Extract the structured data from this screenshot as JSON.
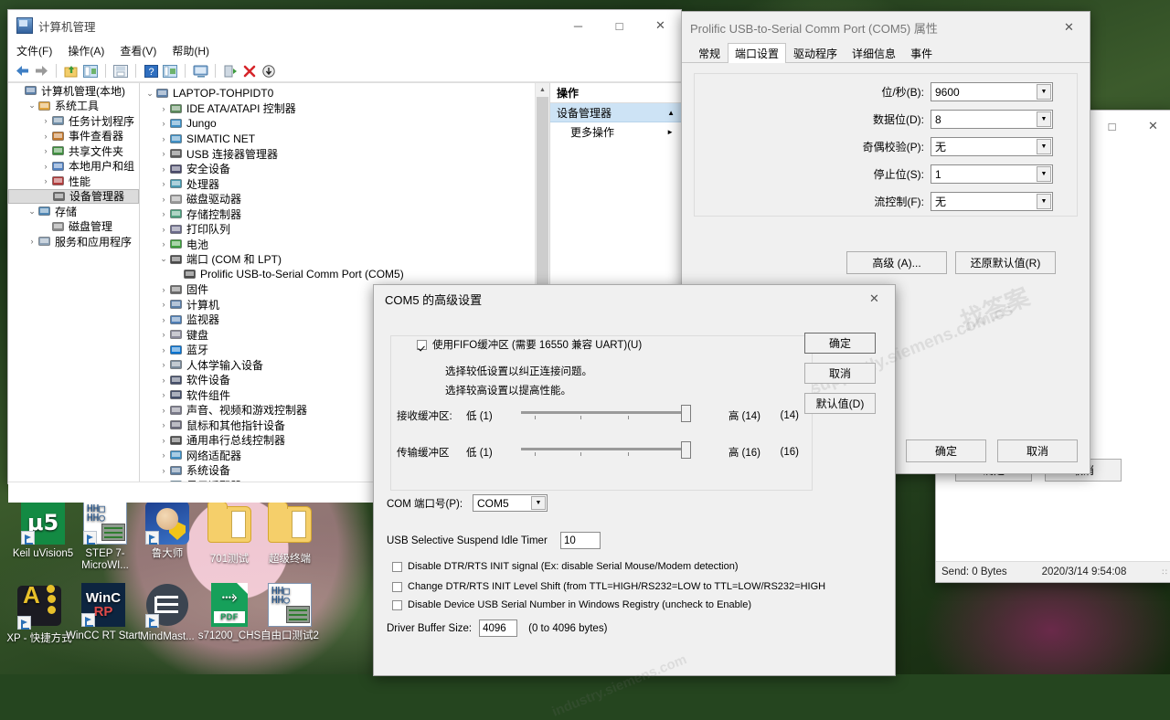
{
  "desktop": {
    "icons": [
      {
        "label": "Keil uVision5",
        "art": "keil"
      },
      {
        "label": "STEP 7-MicroWI...",
        "art": "step7"
      },
      {
        "label": "鲁大师",
        "art": "ludashi"
      },
      {
        "label": "701测试",
        "art": "folder"
      },
      {
        "label": "超级终端",
        "art": "folder"
      },
      {
        "label": "XP - 快捷方式",
        "art": "xpshort"
      },
      {
        "label": "WinCC RT Start",
        "art": "wincc"
      },
      {
        "label": "MindMast...",
        "art": "mind"
      },
      {
        "label": "s71200_CHS",
        "art": "pdf"
      },
      {
        "label": "自由口测试2",
        "art": "step7"
      }
    ]
  },
  "computer_management": {
    "title": "计算机管理",
    "menu": [
      "文件(F)",
      "操作(A)",
      "查看(V)",
      "帮助(H)"
    ],
    "window_buttons": {
      "minimize": "─",
      "maximize": "□",
      "close": "✕"
    },
    "left_tree": [
      {
        "label": "计算机管理(本地)",
        "depth": 0,
        "twisty": "",
        "icon": "computer-icon"
      },
      {
        "label": "系统工具",
        "depth": 1,
        "twisty": "⌄",
        "icon": "tools-icon"
      },
      {
        "label": "任务计划程序",
        "depth": 2,
        "twisty": "›",
        "icon": "clock-icon"
      },
      {
        "label": "事件查看器",
        "depth": 2,
        "twisty": "›",
        "icon": "event-icon"
      },
      {
        "label": "共享文件夹",
        "depth": 2,
        "twisty": "›",
        "icon": "folder-share-icon"
      },
      {
        "label": "本地用户和组",
        "depth": 2,
        "twisty": "›",
        "icon": "users-icon"
      },
      {
        "label": "性能",
        "depth": 2,
        "twisty": "›",
        "icon": "performance-icon"
      },
      {
        "label": "设备管理器",
        "depth": 2,
        "twisty": "",
        "icon": "device-manager-icon",
        "selected": true
      },
      {
        "label": "存储",
        "depth": 1,
        "twisty": "⌄",
        "icon": "storage-icon"
      },
      {
        "label": "磁盘管理",
        "depth": 2,
        "twisty": "",
        "icon": "disk-icon"
      },
      {
        "label": "服务和应用程序",
        "depth": 1,
        "twisty": "›",
        "icon": "services-icon"
      }
    ],
    "device_tree": [
      {
        "label": "LAPTOP-TOHPIDT0",
        "depth": 0,
        "twisty": "⌄",
        "icon": "computer-icon"
      },
      {
        "label": "IDE ATA/ATAPI 控制器",
        "depth": 1,
        "twisty": "›",
        "icon": "ide-icon"
      },
      {
        "label": "Jungo",
        "depth": 1,
        "twisty": "›",
        "icon": "category-icon"
      },
      {
        "label": "SIMATIC NET",
        "depth": 1,
        "twisty": "›",
        "icon": "category-icon"
      },
      {
        "label": "USB 连接器管理器",
        "depth": 1,
        "twisty": "›",
        "icon": "usb-icon"
      },
      {
        "label": "安全设备",
        "depth": 1,
        "twisty": "›",
        "icon": "security-icon"
      },
      {
        "label": "处理器",
        "depth": 1,
        "twisty": "›",
        "icon": "cpu-icon"
      },
      {
        "label": "磁盘驱动器",
        "depth": 1,
        "twisty": "›",
        "icon": "disk-drive-icon"
      },
      {
        "label": "存储控制器",
        "depth": 1,
        "twisty": "›",
        "icon": "storage-ctrl-icon"
      },
      {
        "label": "打印队列",
        "depth": 1,
        "twisty": "›",
        "icon": "printer-icon"
      },
      {
        "label": "电池",
        "depth": 1,
        "twisty": "›",
        "icon": "battery-icon"
      },
      {
        "label": "端口 (COM 和 LPT)",
        "depth": 1,
        "twisty": "⌄",
        "icon": "port-icon"
      },
      {
        "label": "Prolific USB-to-Serial Comm Port (COM5)",
        "depth": 2,
        "twisty": "",
        "icon": "port-icon"
      },
      {
        "label": "固件",
        "depth": 1,
        "twisty": "›",
        "icon": "firmware-icon"
      },
      {
        "label": "计算机",
        "depth": 1,
        "twisty": "›",
        "icon": "computer-icon"
      },
      {
        "label": "监视器",
        "depth": 1,
        "twisty": "›",
        "icon": "monitor-icon"
      },
      {
        "label": "键盘",
        "depth": 1,
        "twisty": "›",
        "icon": "keyboard-icon"
      },
      {
        "label": "蓝牙",
        "depth": 1,
        "twisty": "›",
        "icon": "bluetooth-icon"
      },
      {
        "label": "人体学输入设备",
        "depth": 1,
        "twisty": "›",
        "icon": "hid-icon"
      },
      {
        "label": "软件设备",
        "depth": 1,
        "twisty": "›",
        "icon": "software-device-icon"
      },
      {
        "label": "软件组件",
        "depth": 1,
        "twisty": "›",
        "icon": "software-component-icon"
      },
      {
        "label": "声音、视频和游戏控制器",
        "depth": 1,
        "twisty": "›",
        "icon": "audio-icon"
      },
      {
        "label": "鼠标和其他指针设备",
        "depth": 1,
        "twisty": "›",
        "icon": "mouse-icon"
      },
      {
        "label": "通用串行总线控制器",
        "depth": 1,
        "twisty": "›",
        "icon": "usb-ctrl-icon"
      },
      {
        "label": "网络适配器",
        "depth": 1,
        "twisty": "›",
        "icon": "network-icon"
      },
      {
        "label": "系统设备",
        "depth": 1,
        "twisty": "›",
        "icon": "system-device-icon"
      },
      {
        "label": "显示适配器",
        "depth": 1,
        "twisty": "›",
        "icon": "display-icon"
      }
    ],
    "actions": {
      "header": "操作",
      "group": "设备管理器",
      "more": "更多操作"
    }
  },
  "properties_dialog": {
    "title": "Prolific USB-to-Serial Comm Port (COM5) 属性",
    "close": "✕",
    "tabs": [
      "常规",
      "端口设置",
      "驱动程序",
      "详细信息",
      "事件"
    ],
    "active_tab": "端口设置",
    "fields": [
      {
        "label": "位/秒(B):",
        "value": "9600"
      },
      {
        "label": "数据位(D):",
        "value": "8"
      },
      {
        "label": "奇偶校验(P):",
        "value": "无"
      },
      {
        "label": "停止位(S):",
        "value": "1"
      },
      {
        "label": "流控制(F):",
        "value": "无"
      }
    ],
    "advanced_button": "高级 (A)...",
    "restore_button": "还原默认值(R)",
    "ok_button": "确定",
    "cancel_button": "取消"
  },
  "advanced_dialog": {
    "title": "COM5 的高级设置",
    "close": "✕",
    "fifo_checkbox": {
      "label": "使用FIFO缓冲区 (需要 16550 兼容 UART)(U)",
      "checked": true
    },
    "hint1": "选择较低设置以纠正连接问题。",
    "hint2": "选择较高设置以提高性能。",
    "sliders": [
      {
        "label": "接收缓冲区:",
        "low": "低 (1)",
        "high": "高 (14)",
        "value": "(14)"
      },
      {
        "label": "传输缓冲区",
        "low": "低 (1)",
        "high": "高 (16)",
        "value": "(16)"
      }
    ],
    "buttons": {
      "ok": "确定",
      "cancel": "取消",
      "defaults": "默认值(D)"
    },
    "com_port": {
      "label": "COM 端口号(P):",
      "value": "COM5"
    },
    "idle_timer": {
      "label": "USB Selective Suspend Idle Timer",
      "value": "10"
    },
    "checkboxes": [
      {
        "label": "Disable DTR/RTS INIT signal (Ex: disable Serial Mouse/Modem detection)",
        "checked": false
      },
      {
        "label": "Change DTR/RTS INIT Level Shift (from TTL=HIGH/RS232=LOW to TTL=LOW/RS232=HIGH",
        "checked": false
      },
      {
        "label": "Disable Device USB Serial Number in Windows Registry (uncheck to Enable)",
        "checked": false
      }
    ],
    "driver_buffer": {
      "label": "Driver Buffer Size:",
      "value": "4096",
      "hint": "(0 to 4096 bytes)"
    }
  },
  "serial_window": {
    "window_buttons": {
      "maximize": "□",
      "close": "✕"
    },
    "ok_button": "确定",
    "cancel_button": "取消",
    "status_send": "Send: 0 Bytes",
    "status_time": "2020/3/14 9:54:08",
    "grip": "∷"
  },
  "watermarks": [
    "找答案",
    "supportly.siemens.com.cs",
    "industry.siemens.com"
  ]
}
